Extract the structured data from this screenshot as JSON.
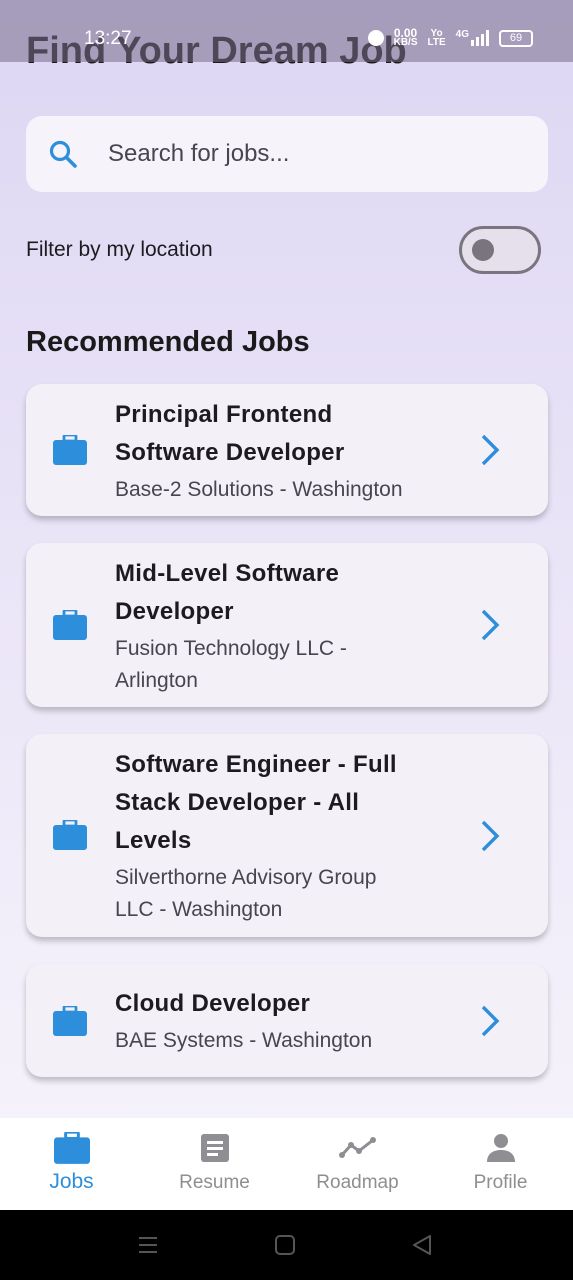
{
  "status_bar": {
    "time": "13:27",
    "net_speed_value": "0.00",
    "net_speed_unit": "KB/S",
    "network_type_top": "Yo",
    "network_type_bottom": "LTE",
    "signal_label": "4G",
    "battery": "69"
  },
  "header": {
    "title": "Find Your Dream Job"
  },
  "search": {
    "placeholder": "Search for jobs...",
    "value": ""
  },
  "filter": {
    "label": "Filter by my location",
    "enabled": false
  },
  "recommended": {
    "title": "Recommended Jobs",
    "jobs": [
      {
        "title_lines": [
          "Principal Frontend",
          "Software Developer"
        ],
        "subtitle_lines": [
          "Base-2 Solutions - Washington"
        ]
      },
      {
        "title_lines": [
          "Mid-Level Software",
          "Developer"
        ],
        "subtitle_lines": [
          "Fusion Technology LLC -",
          "Arlington"
        ]
      },
      {
        "title_lines": [
          "Software Engineer - Full",
          "Stack Developer - All",
          "Levels"
        ],
        "subtitle_lines": [
          "Silverthorne Advisory Group",
          "LLC - Washington"
        ]
      },
      {
        "title_lines": [
          "Cloud Developer"
        ],
        "subtitle_lines": [
          "BAE Systems - Washington"
        ]
      }
    ]
  },
  "bottom_nav": {
    "items": [
      {
        "label": "Jobs",
        "icon": "briefcase-icon",
        "active": true
      },
      {
        "label": "Resume",
        "icon": "document-icon",
        "active": false
      },
      {
        "label": "Roadmap",
        "icon": "trend-line-icon",
        "active": false
      },
      {
        "label": "Profile",
        "icon": "person-icon",
        "active": false
      }
    ]
  },
  "colors": {
    "accent": "#2d8fdc",
    "nav_inactive": "#8e8e93",
    "card_bg": "#f4f0f8"
  }
}
